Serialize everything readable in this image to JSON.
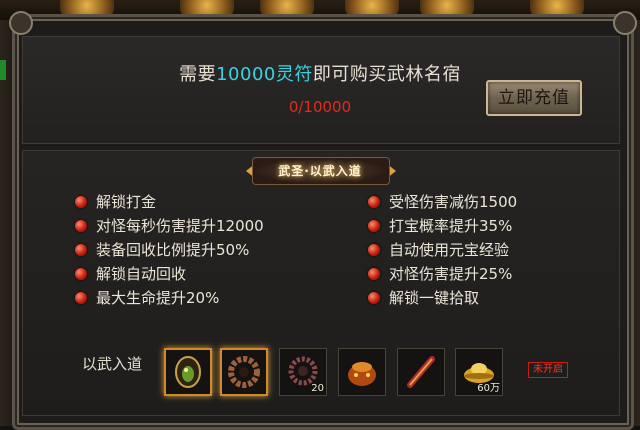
{
  "header": {
    "requirement_prefix": "需要",
    "requirement_amount": "10000灵符",
    "requirement_suffix": "即可购买武林名宿",
    "progress": "0/10000",
    "charge_button": "立即充值"
  },
  "panel": {
    "title": "武圣·以武入道",
    "perks_left": [
      "解锁打金",
      "对怪每秒伤害提升12000",
      "装备回收比例提升50%",
      "解锁自动回收",
      "最大生命提升20%"
    ],
    "perks_right": [
      "受怪伤害减伤1500",
      "打宝概率提升35%",
      "自动使用元宝经验",
      "对怪伤害提升25%",
      "解锁一键拾取"
    ]
  },
  "rewards": {
    "label": "以武入道",
    "items": [
      {
        "icon": "shield-gem-icon",
        "qty": ""
      },
      {
        "icon": "bead-ring-icon",
        "qty": ""
      },
      {
        "icon": "bead-bracelet-icon",
        "qty": "20"
      },
      {
        "icon": "treasure-pot-icon",
        "qty": ""
      },
      {
        "icon": "scroll-icon",
        "qty": ""
      },
      {
        "icon": "gold-ingot-icon",
        "qty": "60万"
      }
    ],
    "status": "未开启"
  }
}
